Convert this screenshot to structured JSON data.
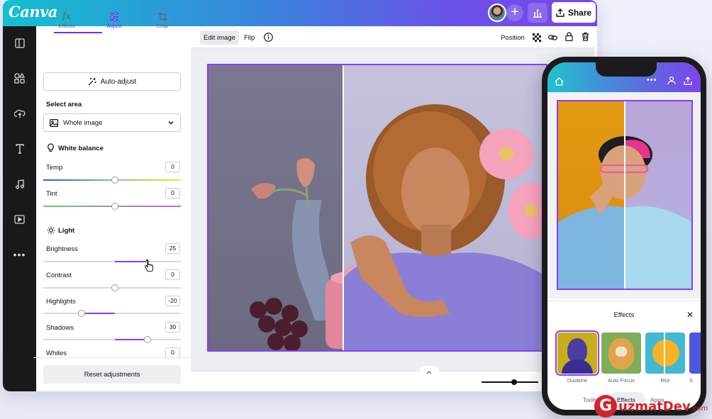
{
  "app": {
    "logo": "Canva",
    "share_label": "Share"
  },
  "colors": {
    "accent": "#8b3dff",
    "topbar_start": "#13c1cf",
    "topbar_end": "#7b45ea",
    "rail": "#18191b",
    "watermark": "#d3232b"
  },
  "rail": {
    "icons": [
      "layout-icon",
      "elements-icon",
      "upload-icon",
      "text-icon",
      "audio-icon",
      "video-icon",
      "more-icon"
    ]
  },
  "panel": {
    "tabs": [
      {
        "label": "Effects",
        "icon": "fx-icon"
      },
      {
        "label": "Adjust",
        "icon": "sliders-icon",
        "active": true
      },
      {
        "label": "Crop",
        "icon": "crop-icon"
      }
    ],
    "auto_adjust": "Auto-adjust",
    "select_area_label": "Select area",
    "select_area_value": "Whole image",
    "white_balance": "White balance",
    "light": "Light",
    "sliders": {
      "temp": {
        "label": "Temp",
        "value": "0"
      },
      "tint": {
        "label": "Tint",
        "value": "0"
      },
      "brightness": {
        "label": "Brightness",
        "value": "25"
      },
      "contrast": {
        "label": "Contrast",
        "value": "0"
      },
      "highlights": {
        "label": "Highlights",
        "value": "-20"
      },
      "shadows": {
        "label": "Shadows",
        "value": "30"
      },
      "whites": {
        "label": "Whites",
        "value": "0"
      }
    },
    "reset": "Reset adjustments"
  },
  "editor": {
    "edit_image": "Edit image",
    "flip": "Flip",
    "position": "Position"
  },
  "phone": {
    "effects_title": "Effects",
    "effects": [
      {
        "label": "Duotone",
        "selected": true
      },
      {
        "label": "Auto Focus"
      },
      {
        "label": "Blur"
      },
      {
        "label": "S"
      }
    ],
    "tabs": [
      "Tools",
      "Effects",
      "Apps"
    ]
  },
  "watermark": {
    "brand_initial": "G",
    "brand": "uzmatDev",
    "domain": ".com"
  }
}
